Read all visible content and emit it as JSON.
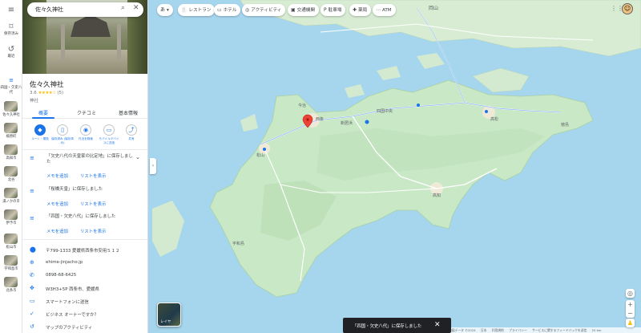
{
  "search": {
    "value": "佐々久神社"
  },
  "place": {
    "name": "佐々久神社",
    "rating": "3.6",
    "stars": "★★★★☆",
    "reviews": "(5)",
    "category": "神社"
  },
  "tabs": [
    "概要",
    "クチコミ",
    "基本情報"
  ],
  "actions": [
    {
      "icon": "◆",
      "label": "ルート・乗換"
    },
    {
      "icon": "▯",
      "label": "保存済み\n(保存済み)"
    },
    {
      "icon": "◉",
      "label": "付近を検索"
    },
    {
      "icon": "▭",
      "label": "モバイルデバイスに送信"
    },
    {
      "icon": "⤴",
      "label": "共有"
    }
  ],
  "saved_lists": [
    {
      "text": "「欠史八代の天皇家の比定地」に保存しました",
      "note": "メモを追加",
      "show": "リストを表示"
    },
    {
      "text": "「桜橋天皇」に保存しました",
      "note": "メモを追加",
      "show": "リストを表示"
    },
    {
      "text": "「四国・欠史八代」に保存しました",
      "note": "メモを追加",
      "show": "リストを表示"
    }
  ],
  "info": [
    {
      "icon": "⬤",
      "text": "〒799-1333 愛媛県西条市安用５１２"
    },
    {
      "icon": "⊕",
      "text": "ehime-jinjacho.jp"
    },
    {
      "icon": "✆",
      "text": "0898-68-6425"
    },
    {
      "icon": "✥",
      "text": "W3H3+5P 西条市、愛媛県"
    },
    {
      "icon": "▭",
      "text": "スマートフォンに送信"
    },
    {
      "icon": "✓",
      "text": "ビジネス オーナーですか？"
    },
    {
      "icon": "↺",
      "text": "マップのアクティビティ"
    }
  ],
  "rail": {
    "saved": "保存済み",
    "recent": "最近",
    "list_label": "四国・欠史八代",
    "thumbs": [
      "佐々久神社",
      "楠原町",
      "高知市",
      "北谷",
      "湯ノかの市",
      "伊予市",
      "松山市",
      "宇和島市",
      "北条市"
    ]
  },
  "chips": [
    {
      "icon": "あ",
      "label": "▾"
    },
    {
      "icon": "🍴",
      "label": "レストラン"
    },
    {
      "icon": "▭",
      "label": "ホテル"
    },
    {
      "icon": "◎",
      "label": "アクティビティ"
    },
    {
      "icon": "▣",
      "label": "交通機関"
    },
    {
      "icon": "P",
      "label": "駐車場"
    },
    {
      "icon": "✚",
      "label": "薬局"
    },
    {
      "icon": "⋯",
      "label": "ATM"
    }
  ],
  "layers_label": "レイヤ",
  "toast": {
    "text": "「四国・欠史八代」に保存しました"
  },
  "footer": [
    "地図データ ©2024",
    "日本",
    "利用規約",
    "プライバシー",
    "サービスに関するフィードバックを送信",
    "20 km"
  ],
  "map_labels": [
    "岡山",
    "高松",
    "西条",
    "松山",
    "高知",
    "宇和島",
    "今治",
    "新居浜",
    "徳島",
    "四国中央"
  ],
  "colors": {
    "accent": "#1a73e8",
    "pin": "#ea4335",
    "sea": "#a6d6ee",
    "land": "#c9e8c6",
    "toast": "#202124"
  }
}
